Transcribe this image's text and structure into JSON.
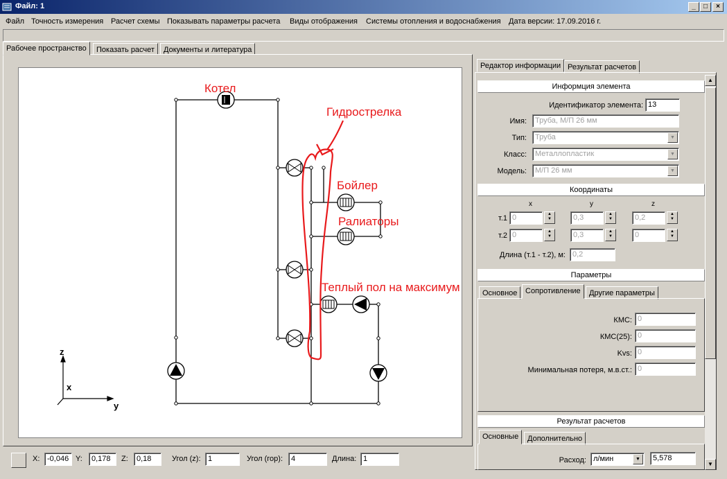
{
  "window": {
    "title": "Файл: 1"
  },
  "menu": [
    "Файл",
    "Точность измерения",
    "Расчет схемы",
    "Показывать параметры расчета",
    "Виды отображения",
    "Системы отопления и водоснабжения",
    "Дата версии: 17.09.2016 г."
  ],
  "main_tabs": [
    "Рабочее пространство",
    "Показать расчет",
    "Документы и литература"
  ],
  "diagram": {
    "annotations": {
      "boiler_main": "Котел",
      "hydro_arrow": "Гидрострелка",
      "boiler_water": "Бойлер",
      "radiators": "Ралиаторы",
      "floor_heating": "Теплый пол на максимум"
    },
    "axes": {
      "z": "z",
      "x": "x",
      "y": "y"
    }
  },
  "right_tabs": [
    "Редактор информации",
    "Результат расчетов"
  ],
  "element_info": {
    "header": "Информция элемента",
    "id_label": "Идентификатор элемента:",
    "id_value": "13",
    "name_label": "Имя:",
    "name_value": "Труба, М/П 26 мм",
    "type_label": "Тип:",
    "type_value": "Труба",
    "class_label": "Класс:",
    "class_value": "Металлопластик",
    "model_label": "Модель:",
    "model_value": "М/П 26 мм"
  },
  "coords": {
    "header": "Координаты",
    "col_x": "x",
    "col_y": "y",
    "col_z": "z",
    "p1_label": "т.1",
    "p1": [
      "0",
      "0,3",
      "0,2"
    ],
    "p2_label": "т.2",
    "p2": [
      "0",
      "0,3",
      "0"
    ],
    "length_label": "Длина (т.1 - т.2), м:",
    "length_value": "0,2"
  },
  "params": {
    "header": "Параметры",
    "tabs": [
      "Основное",
      "Сопротивление",
      "Другие параметры"
    ],
    "kms_label": "КМС:",
    "kms_value": "0",
    "kms25_label": "КМС(25):",
    "kms25_value": "0",
    "kvs_label": "Kvs:",
    "kvs_value": "0",
    "minloss_label": "Минимальная потеря, м.в.ст.:",
    "minloss_value": "0"
  },
  "results": {
    "header": "Результат расчетов",
    "tabs": [
      "Основные",
      "Дополнительно"
    ],
    "flow_label": "Расход:",
    "flow_unit": "л/мин",
    "flow_value": "5,578"
  },
  "status": {
    "x_label": "X:",
    "x_value": "-0,046",
    "y_label": "Y:",
    "y_value": "0,178",
    "z_label": "Z:",
    "z_value": "0,18",
    "angle_z_label": "Угол (z):",
    "angle_z_value": "1",
    "angle_h_label": "Угол (гор):",
    "angle_h_value": "4",
    "length_label": "Длина:",
    "length_value": "1"
  },
  "colors": {
    "annotation": "#e8191b",
    "titlebar": "#0a246a"
  }
}
